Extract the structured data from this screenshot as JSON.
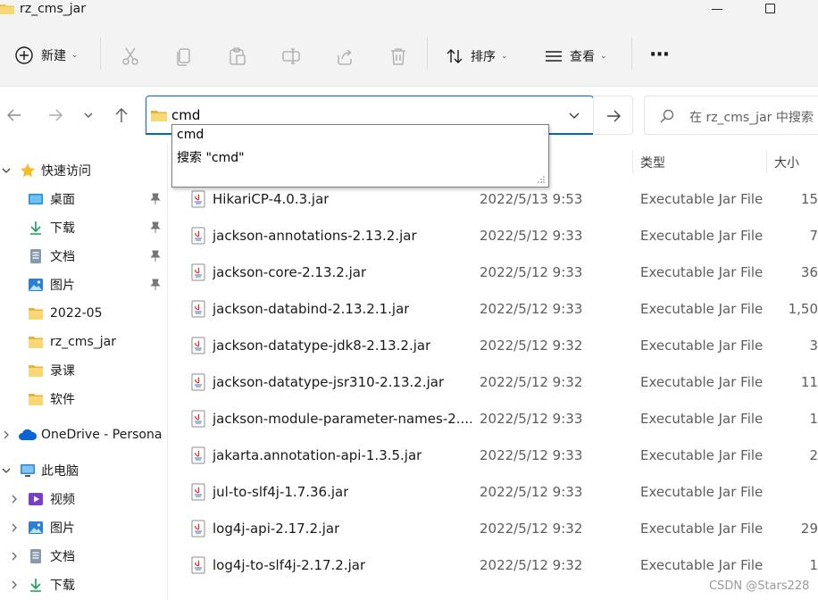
{
  "window": {
    "title": "rz_cms_jar"
  },
  "toolbar": {
    "new_label": "新建",
    "sort_label": "排序",
    "view_label": "查看",
    "more_label": "···"
  },
  "address": {
    "value": "cmd",
    "search_placeholder": "在 rz_cms_jar 中搜索"
  },
  "autocomplete": {
    "options": [
      "cmd",
      "搜索 \"cmd\""
    ]
  },
  "sidebar": {
    "quick_access": "快速访问",
    "items": [
      {
        "label": "桌面",
        "icon": "desktop-icon"
      },
      {
        "label": "下载",
        "icon": "download-icon"
      },
      {
        "label": "文档",
        "icon": "document-icon"
      },
      {
        "label": "图片",
        "icon": "pictures-icon"
      },
      {
        "label": "2022-05",
        "icon": "folder-icon"
      },
      {
        "label": "rz_cms_jar",
        "icon": "folder-icon"
      },
      {
        "label": "录课",
        "icon": "folder-icon"
      },
      {
        "label": "软件",
        "icon": "folder-icon"
      }
    ],
    "onedrive": "OneDrive - Persona",
    "this_pc": "此电脑",
    "pc_items": [
      {
        "label": "视频",
        "icon": "video-icon"
      },
      {
        "label": "图片",
        "icon": "pictures-icon"
      },
      {
        "label": "文档",
        "icon": "document-icon"
      },
      {
        "label": "下载",
        "icon": "download-icon"
      }
    ]
  },
  "columns": {
    "type": "类型",
    "size": "大小"
  },
  "files": [
    {
      "name": "HikariCP-4.0.3.jar",
      "date": "2022/5/13 9:53",
      "type": "Executable Jar File",
      "size": "15"
    },
    {
      "name": "jackson-annotations-2.13.2.jar",
      "date": "2022/5/12 9:33",
      "type": "Executable Jar File",
      "size": "7"
    },
    {
      "name": "jackson-core-2.13.2.jar",
      "date": "2022/5/12 9:33",
      "type": "Executable Jar File",
      "size": "36"
    },
    {
      "name": "jackson-databind-2.13.2.1.jar",
      "date": "2022/5/12 9:33",
      "type": "Executable Jar File",
      "size": "1,50"
    },
    {
      "name": "jackson-datatype-jdk8-2.13.2.jar",
      "date": "2022/5/12 9:32",
      "type": "Executable Jar File",
      "size": "3"
    },
    {
      "name": "jackson-datatype-jsr310-2.13.2.jar",
      "date": "2022/5/12 9:32",
      "type": "Executable Jar File",
      "size": "11"
    },
    {
      "name": "jackson-module-parameter-names-2....",
      "date": "2022/5/12 9:33",
      "type": "Executable Jar File",
      "size": "1"
    },
    {
      "name": "jakarta.annotation-api-1.3.5.jar",
      "date": "2022/5/12 9:33",
      "type": "Executable Jar File",
      "size": "2"
    },
    {
      "name": "jul-to-slf4j-1.7.36.jar",
      "date": "2022/5/12 9:33",
      "type": "Executable Jar File",
      "size": ""
    },
    {
      "name": "log4j-api-2.17.2.jar",
      "date": "2022/5/12 9:32",
      "type": "Executable Jar File",
      "size": "29"
    },
    {
      "name": "log4j-to-slf4j-2.17.2.jar",
      "date": "2022/5/12 9:32",
      "type": "Executable Jar File",
      "size": "1"
    }
  ],
  "watermark": "CSDN @Stars228",
  "colors": {
    "accent": "#0067c0",
    "folder": "#f2c14e",
    "chrome": "#f3f3f3"
  }
}
